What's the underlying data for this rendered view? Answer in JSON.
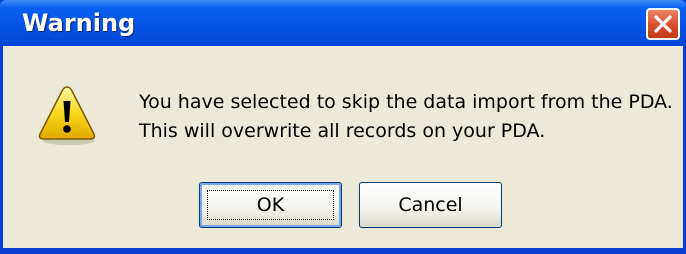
{
  "window": {
    "title": "Warning"
  },
  "icons": {
    "warning": "warning-icon",
    "close": "close-icon"
  },
  "message": {
    "line1": "You have selected to skip the data import from the PDA.",
    "line2": "This will overwrite all records on your PDA."
  },
  "buttons": {
    "ok_label": "OK",
    "cancel_label": "Cancel"
  },
  "colors": {
    "titlebar": "#0653e6",
    "close_button": "#d8542f",
    "dialog_background": "#ece9d8",
    "warning_yellow": "#f8d81c"
  }
}
